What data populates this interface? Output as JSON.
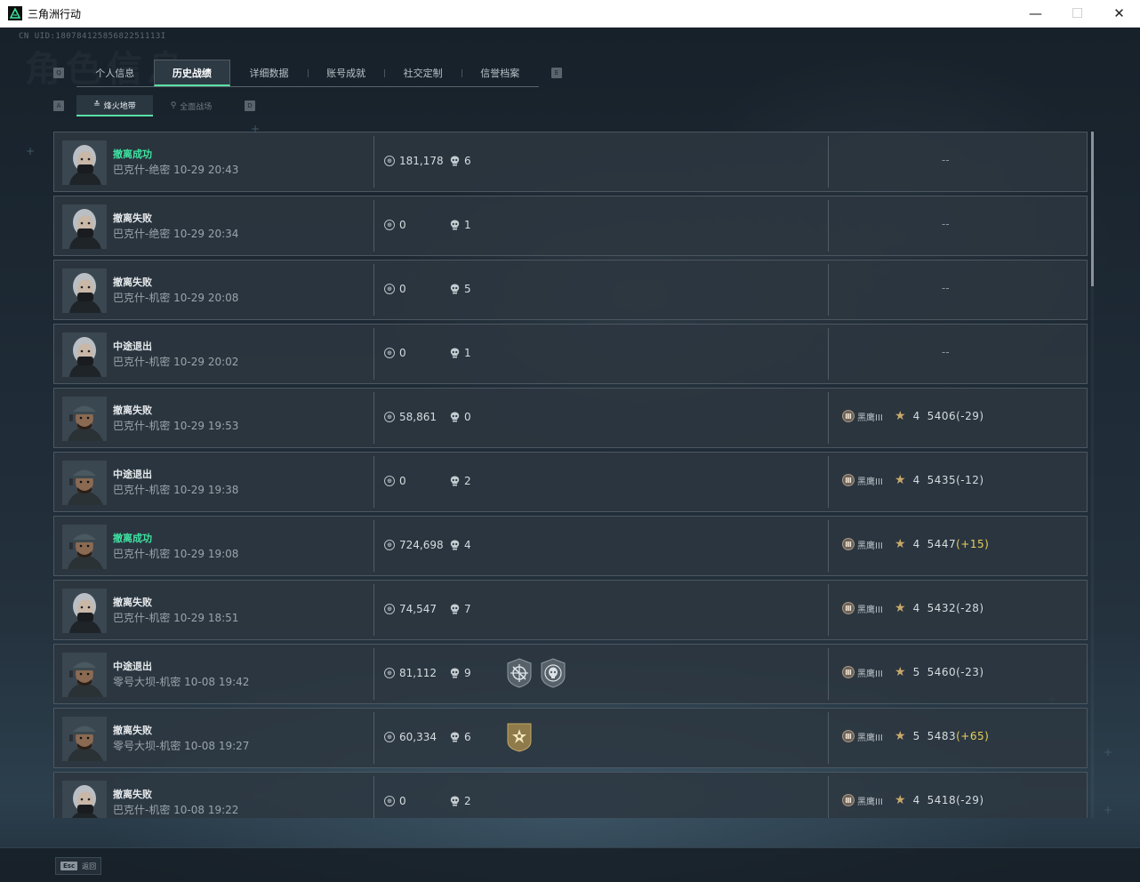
{
  "window": {
    "title": "三角洲行动",
    "minimize": "—",
    "maximize": "☐",
    "close": "✕"
  },
  "header": {
    "uid": "CN UID:18078412585682251113I",
    "watermark": "角色信息",
    "left_key": "Q",
    "right_key": "E",
    "sub_left_key": "A",
    "sub_right_key": "D"
  },
  "main_tabs": [
    {
      "label": "个人信息",
      "active": false
    },
    {
      "label": "历史战绩",
      "active": true
    },
    {
      "label": "详细数据",
      "active": false
    },
    {
      "label": "账号成就",
      "active": false
    },
    {
      "label": "社交定制",
      "active": false
    },
    {
      "label": "信誉档案",
      "active": false
    }
  ],
  "sub_tabs": [
    {
      "label": "烽火地带",
      "icon": "≛",
      "active": true
    },
    {
      "label": "全面战场",
      "icon": "⚲",
      "active": false
    }
  ],
  "colors": {
    "accent": "#5ae0a6",
    "success": "#3fe3a2",
    "positive_delta": "#e8d05a"
  },
  "records": [
    {
      "status": "撤离成功",
      "success": true,
      "map_time": "巴克什-绝密 10-29 20:43",
      "operator": "female",
      "coins": "181,178",
      "kills": "6",
      "medals": [],
      "rank": null,
      "placeholder": "--"
    },
    {
      "status": "撤离失败",
      "success": false,
      "map_time": "巴克什-绝密 10-29 20:34",
      "operator": "female",
      "coins": "0",
      "kills": "1",
      "medals": [],
      "rank": null,
      "placeholder": "--"
    },
    {
      "status": "撤离失败",
      "success": false,
      "map_time": "巴克什-机密 10-29 20:08",
      "operator": "female",
      "coins": "0",
      "kills": "5",
      "medals": [],
      "rank": null,
      "placeholder": "--"
    },
    {
      "status": "中途退出",
      "success": false,
      "map_time": "巴克什-机密 10-29 20:02",
      "operator": "female",
      "coins": "0",
      "kills": "1",
      "medals": [],
      "rank": null,
      "placeholder": "--"
    },
    {
      "status": "撤离失败",
      "success": false,
      "map_time": "巴克什-机密 10-29 19:53",
      "operator": "male",
      "coins": "58,861",
      "kills": "0",
      "medals": [],
      "rank": {
        "badge": "Ⅲ",
        "name": "黑鹰III",
        "stars": "4",
        "score": "5406",
        "delta": "(-29)",
        "plus": false
      }
    },
    {
      "status": "中途退出",
      "success": false,
      "map_time": "巴克什-机密 10-29 19:38",
      "operator": "male",
      "coins": "0",
      "kills": "2",
      "medals": [],
      "rank": {
        "badge": "Ⅲ",
        "name": "黑鹰III",
        "stars": "4",
        "score": "5435",
        "delta": "(-12)",
        "plus": false
      }
    },
    {
      "status": "撤离成功",
      "success": true,
      "map_time": "巴克什-机密 10-29 19:08",
      "operator": "male",
      "coins": "724,698",
      "kills": "4",
      "medals": [],
      "rank": {
        "badge": "Ⅲ",
        "name": "黑鹰III",
        "stars": "4",
        "score": "5447",
        "delta": "(+15)",
        "plus": true
      }
    },
    {
      "status": "撤离失败",
      "success": false,
      "map_time": "巴克什-机密 10-29 18:51",
      "operator": "female",
      "coins": "74,547",
      "kills": "7",
      "medals": [],
      "rank": {
        "badge": "Ⅲ",
        "name": "黑鹰III",
        "stars": "4",
        "score": "5432",
        "delta": "(-28)",
        "plus": false
      }
    },
    {
      "status": "中途退出",
      "success": false,
      "map_time": "零号大坝-机密 10-08 19:42",
      "operator": "male",
      "coins": "81,112",
      "kills": "9",
      "medals": [
        "crosshair-medal",
        "skull-medal"
      ],
      "rank": {
        "badge": "Ⅲ",
        "name": "黑鹰III",
        "stars": "5",
        "score": "5460",
        "delta": "(-23)",
        "plus": false
      }
    },
    {
      "status": "撤离失败",
      "success": false,
      "map_time": "零号大坝-机密 10-08 19:27",
      "operator": "male",
      "coins": "60,334",
      "kills": "6",
      "medals": [
        "gold-star-medal"
      ],
      "rank": {
        "badge": "Ⅲ",
        "name": "黑鹰III",
        "stars": "5",
        "score": "5483",
        "delta": "(+65)",
        "plus": true
      }
    },
    {
      "status": "撤离失败",
      "success": false,
      "map_time": "巴克什-机密 10-08 19:22",
      "operator": "female",
      "coins": "0",
      "kills": "2",
      "medals": [],
      "rank": {
        "badge": "Ⅲ",
        "name": "黑鹰III",
        "stars": "4",
        "score": "5418",
        "delta": "(-29)",
        "plus": false
      }
    }
  ],
  "footer": {
    "esc_key": "Esc",
    "esc_label": "返回"
  }
}
